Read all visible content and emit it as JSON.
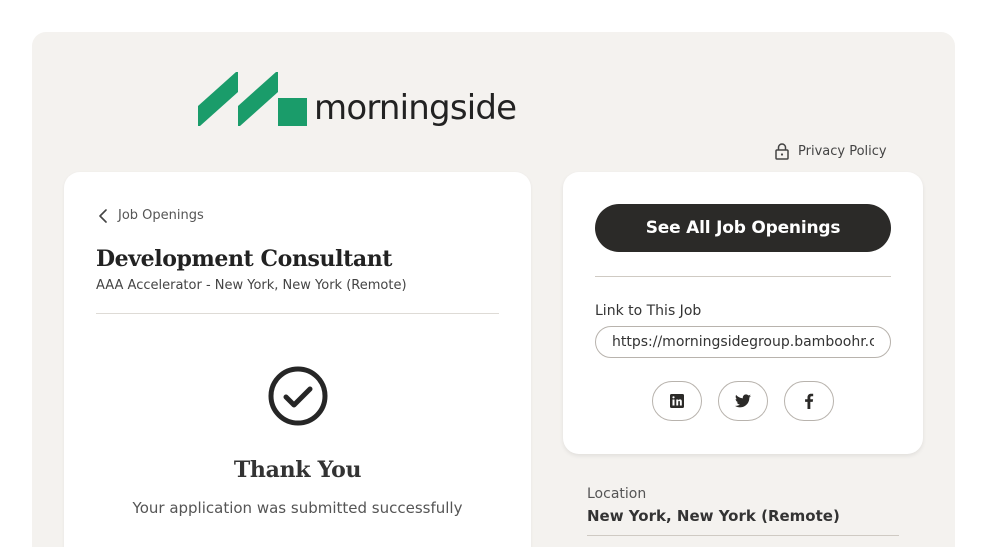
{
  "brand": {
    "logo_text": "morningside",
    "brand_color": "#1a9c6a"
  },
  "header": {
    "privacy_label": "Privacy Policy"
  },
  "job": {
    "back_label": "Job Openings",
    "title": "Development Consultant",
    "subtitle": "AAA Accelerator - New York, New York (Remote)"
  },
  "confirmation": {
    "title": "Thank You",
    "message": "Your application was submitted successfully"
  },
  "sidebar": {
    "see_all_label": "See All Job Openings",
    "link_label": "Link to This Job",
    "link_value": "https://morningsidegroup.bamboohr.com",
    "social": [
      "linkedin-icon",
      "twitter-icon",
      "facebook-icon"
    ]
  },
  "details": {
    "location_label": "Location",
    "location_value": "New York, New York (Remote)"
  }
}
